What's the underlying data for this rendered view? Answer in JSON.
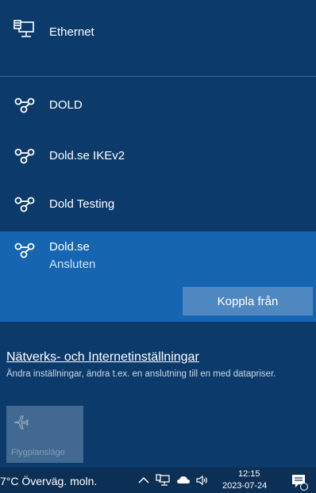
{
  "ethernet": {
    "label": "Ethernet",
    "icon": "computer-network-icon"
  },
  "vpn_items": [
    {
      "label": "DOLD",
      "icon": "vpn-icon"
    },
    {
      "label": "Dold.se IKEv2",
      "icon": "vpn-icon"
    },
    {
      "label": "Dold Testing",
      "icon": "vpn-icon"
    }
  ],
  "selected_vpn": {
    "label": "Dold.se",
    "status": "Ansluten",
    "disconnect_label": "Koppla från",
    "icon": "vpn-icon"
  },
  "settings": {
    "link": "Nätverks- och Internetinställningar",
    "description": "Ändra inställningar, ändra t.ex. en anslutning till en med datapriser."
  },
  "quick_actions": [
    {
      "label": "Flygplansläge",
      "icon": "airplane-icon"
    }
  ],
  "taskbar": {
    "weather": "7°C Överväg. moln.",
    "time": "12:15",
    "date": "2023-07-24",
    "icons": [
      "chevron-up-icon",
      "network-icon",
      "onedrive-cloud-icon",
      "speaker-icon",
      "notification-icon"
    ]
  },
  "colors": {
    "panel": "#0c3b6b",
    "selected": "#1565b0",
    "button": "#4f87c1",
    "taskbar": "#0c2f55"
  }
}
